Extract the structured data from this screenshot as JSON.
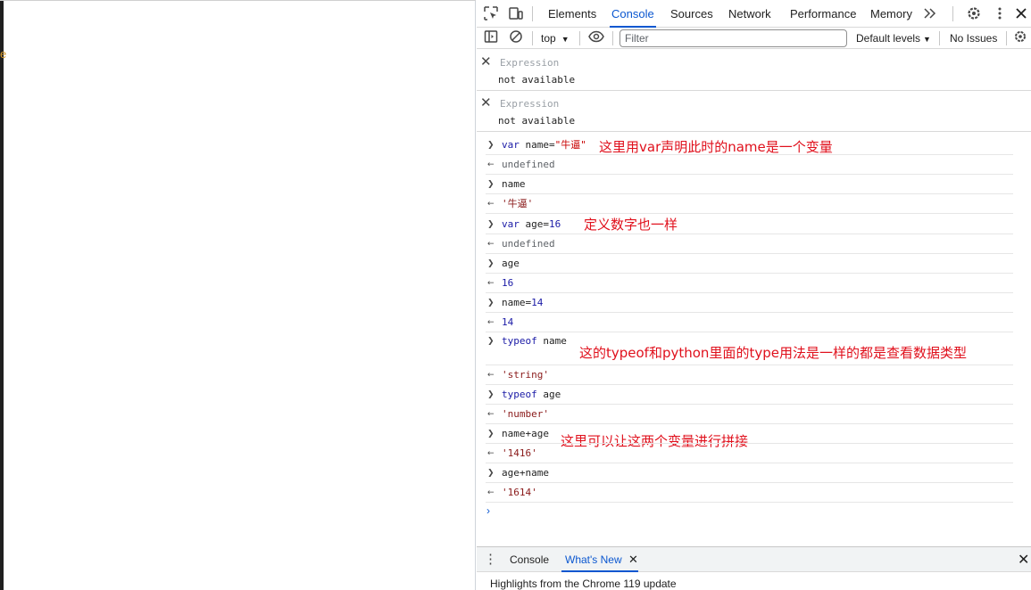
{
  "devtools": {
    "tabs": [
      "Elements",
      "Console",
      "Sources",
      "Network",
      "Performance",
      "Memory"
    ],
    "active_tab": "Console",
    "icons": {
      "inspect": "inspect-element-icon",
      "device": "device-toolbar-icon",
      "more_tabs": "chevron-double-right-icon",
      "settings": "gear-icon",
      "menu": "kebab-menu-icon",
      "close": "close-icon"
    }
  },
  "toolbar": {
    "context": "top",
    "filter_placeholder": "Filter",
    "levels": "Default levels",
    "issues": "No Issues"
  },
  "expressions": [
    {
      "label": "Expression",
      "value": "not available"
    },
    {
      "label": "Expression",
      "value": "not available"
    }
  ],
  "console": {
    "rows": [
      {
        "dir": "in",
        "parts": [
          {
            "t": "var ",
            "c": "kw"
          },
          {
            "t": "name=",
            "c": "plain"
          },
          {
            "t": "\"牛逼\"",
            "c": "str"
          }
        ]
      },
      {
        "dir": "out",
        "parts": [
          {
            "t": "undefined",
            "c": "und"
          }
        ]
      },
      {
        "dir": "in",
        "parts": [
          {
            "t": "name",
            "c": "plain"
          }
        ]
      },
      {
        "dir": "out",
        "parts": [
          {
            "t": "'牛逼'",
            "c": "res-str"
          }
        ]
      },
      {
        "dir": "in",
        "parts": [
          {
            "t": "var ",
            "c": "kw"
          },
          {
            "t": "age=",
            "c": "plain"
          },
          {
            "t": "16",
            "c": "num"
          }
        ]
      },
      {
        "dir": "out",
        "parts": [
          {
            "t": "undefined",
            "c": "und"
          }
        ]
      },
      {
        "dir": "in",
        "parts": [
          {
            "t": "age",
            "c": "plain"
          }
        ]
      },
      {
        "dir": "out",
        "parts": [
          {
            "t": "16",
            "c": "num"
          }
        ]
      },
      {
        "dir": "in",
        "parts": [
          {
            "t": "name=",
            "c": "plain"
          },
          {
            "t": "14",
            "c": "num"
          }
        ]
      },
      {
        "dir": "out",
        "parts": [
          {
            "t": "14",
            "c": "num"
          }
        ]
      },
      {
        "dir": "in",
        "parts": [
          {
            "t": "typeof ",
            "c": "kw"
          },
          {
            "t": "name",
            "c": "plain"
          }
        ]
      },
      {
        "dir": "out",
        "parts": [
          {
            "t": "'string'",
            "c": "res-str"
          }
        ]
      },
      {
        "dir": "in",
        "parts": [
          {
            "t": "typeof ",
            "c": "kw"
          },
          {
            "t": "age",
            "c": "plain"
          }
        ]
      },
      {
        "dir": "out",
        "parts": [
          {
            "t": "'number'",
            "c": "res-str"
          }
        ]
      },
      {
        "dir": "in",
        "parts": [
          {
            "t": "name+age",
            "c": "plain"
          }
        ]
      },
      {
        "dir": "out",
        "parts": [
          {
            "t": "'1416'",
            "c": "res-str"
          }
        ]
      },
      {
        "dir": "in",
        "parts": [
          {
            "t": "age+name",
            "c": "plain"
          }
        ]
      },
      {
        "dir": "out",
        "parts": [
          {
            "t": "'1614'",
            "c": "res-str"
          }
        ]
      }
    ],
    "notes": [
      "这里用var声明此时的name是一个变量",
      "定义数字也一样",
      "这的typeof和python里面的type用法是一样的都是查看数据类型",
      "这里可以让这两个变量进行拼接"
    ],
    "prompt": "›"
  },
  "drawer": {
    "tabs": [
      "Console",
      "What's New"
    ],
    "active_tab": "What's New",
    "news": "Highlights from the Chrome 119 update"
  },
  "colors": {
    "accent": "#0b57d0",
    "annotation": "#e0101c",
    "string": "#c80000",
    "number": "#1a1aa6"
  }
}
